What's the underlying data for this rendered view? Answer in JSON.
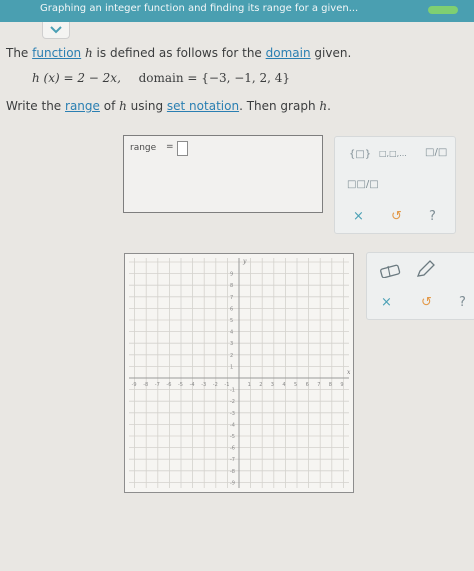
{
  "header": {
    "title": "Graphing an integer function and finding its range for a given..."
  },
  "problem": {
    "intro_prefix": "The ",
    "function_link": "function",
    "intro_mid": " ",
    "intro_var": "h",
    "intro_mid2": " is defined as follows for the ",
    "domain_link": "domain",
    "intro_suffix": " given.",
    "equation_lhs": "h (x) = 2 − 2x,",
    "domain_label": "domain = {−3, −1, 2, 4}",
    "write_prefix": "Write the ",
    "range_link": "range",
    "write_mid": " of ",
    "write_var": "h",
    "write_mid2": " using ",
    "set_notation_link": "set notation",
    "write_suffix": ". Then graph ",
    "write_var2": "h",
    "write_end": "."
  },
  "answer": {
    "range_label": "range",
    "equals": "=",
    "input_value": ""
  },
  "tools": {
    "set_braces": "{□}",
    "ellipsis": "□,□,...",
    "fraction": "□/□",
    "mixed": "□□/□",
    "clear": "×",
    "undo": "↺",
    "help": "?"
  },
  "graph_tools": {
    "eraser": "eraser",
    "pencil": "pencil",
    "clear": "×",
    "undo": "↺",
    "help": "?"
  },
  "graph": {
    "x_axis_label": "x",
    "y_axis_label": "y",
    "x_ticks": [
      "-9",
      "-8",
      "-7",
      "-6",
      "-5",
      "-4",
      "-3",
      "-2",
      "-1",
      "1",
      "2",
      "3",
      "4",
      "5",
      "6",
      "7",
      "8",
      "9"
    ],
    "y_ticks": [
      "9",
      "8",
      "7",
      "6",
      "5",
      "4",
      "3",
      "2",
      "1",
      "-1",
      "-2",
      "-3",
      "-4",
      "-5",
      "-6",
      "-7",
      "-8",
      "-9"
    ]
  }
}
